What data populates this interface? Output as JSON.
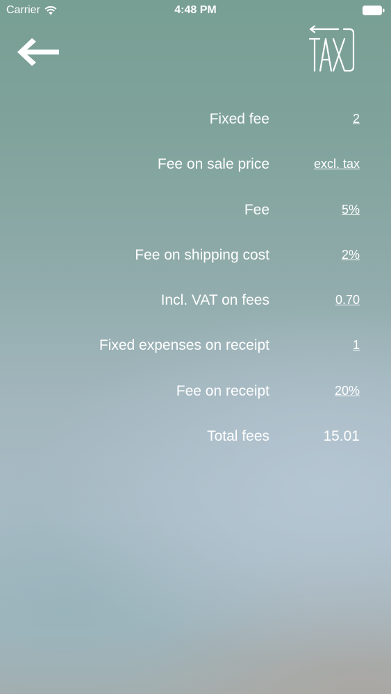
{
  "status_bar": {
    "carrier": "Carrier",
    "time": "4:48 PM"
  },
  "header": {
    "back_icon": "arrow-left-icon",
    "tax_icon": "tax-icon",
    "tax_icon_text": "TAX"
  },
  "fees": {
    "rows": [
      {
        "label": "Fixed fee",
        "value": "2"
      },
      {
        "label": "Fee on sale price",
        "value": "excl. tax"
      },
      {
        "label": "Fee",
        "value": "5%"
      },
      {
        "label": "Fee on shipping cost",
        "value": "2%"
      },
      {
        "label": "Incl. VAT on fees",
        "value": "0.70"
      },
      {
        "label": "Fixed expenses on receipt",
        "value": "1"
      },
      {
        "label": "Fee on receipt",
        "value": "20%"
      }
    ],
    "total": {
      "label": "Total fees",
      "value": "15.01"
    }
  },
  "colors": {
    "text": "#ffffff",
    "background_top": "#789f94",
    "background_bottom": "#a9bcc6"
  }
}
